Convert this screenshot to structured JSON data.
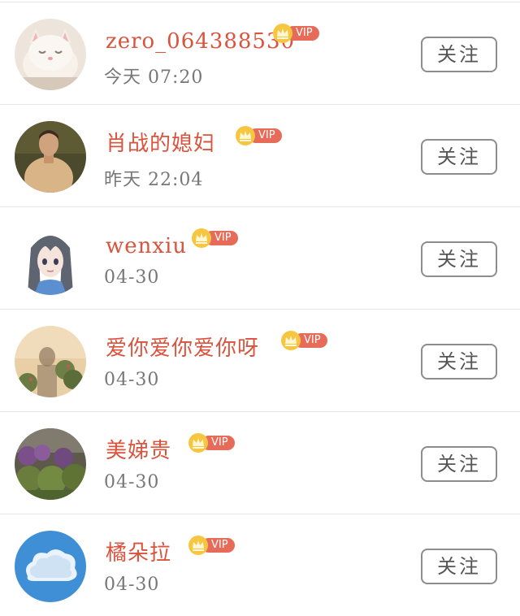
{
  "vip_label": "VIP",
  "follow_label": "关注",
  "colors": {
    "name": "#d9533d",
    "vip_tag": "#e66b58",
    "vip_crown": "#f7c640",
    "time": "#777777",
    "button_border": "#8d8d8d"
  },
  "users": [
    {
      "name": "zero_064388530",
      "time": "今天  07:20",
      "avatar": "cat"
    },
    {
      "name": "肖战的媳妇",
      "time": "昨天  22:04",
      "avatar": "person"
    },
    {
      "name": "wenxiu",
      "time": "04-30",
      "avatar": "anime-girl"
    },
    {
      "name": "爱你爱你爱你呀",
      "time": "04-30",
      "avatar": "shadow-flowers"
    },
    {
      "name": "美娣贵",
      "time": "04-30",
      "avatar": "bushes"
    },
    {
      "name": "橘朵拉",
      "time": "04-30",
      "avatar": "cloud"
    }
  ]
}
